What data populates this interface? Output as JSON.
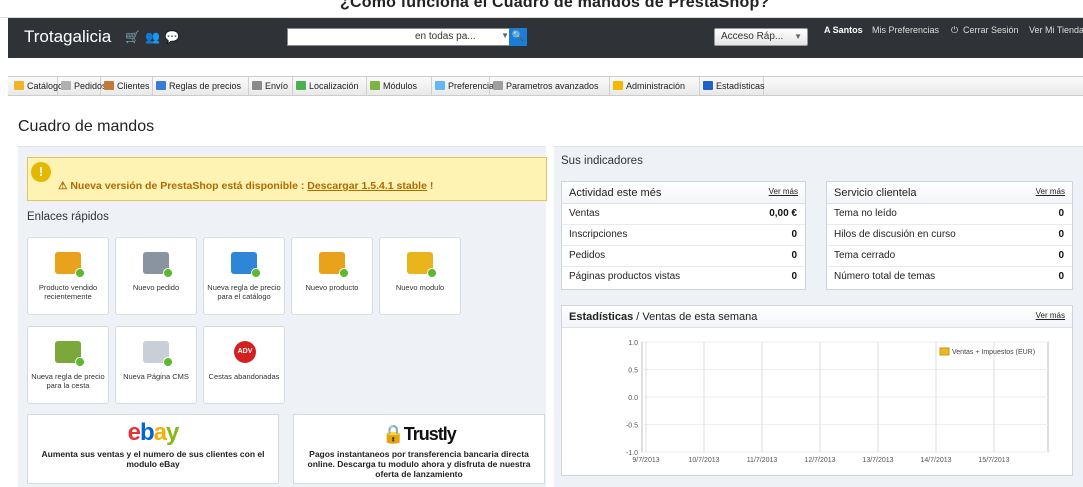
{
  "top_band_title": "¿Cómo funciona el Cuadro de mandos de PrestaShop?",
  "header": {
    "logo": "Trotagalicia",
    "search_scope": "en todas pa...",
    "quick_access": "Acceso Ráp...",
    "user_name": "A Santos",
    "preferences": "Mis Preferencias",
    "logout": "Cerrar Sesión",
    "view_store": "Ver Mi Tienda"
  },
  "menu": [
    {
      "label": "Catálogo",
      "color": "#f0b429"
    },
    {
      "label": "Pedidos",
      "color": "#b0b0b0"
    },
    {
      "label": "Clientes",
      "color": "#c07a3a"
    },
    {
      "label": "Reglas de precios",
      "color": "#3a7bd5"
    },
    {
      "label": "Envío",
      "color": "#8a8a8a"
    },
    {
      "label": "Localización",
      "color": "#4caf50"
    },
    {
      "label": "Módulos",
      "color": "#7cb342"
    },
    {
      "label": "Preferencias",
      "color": "#64b5f6"
    },
    {
      "label": "Parametros avanzados",
      "color": "#9e9e9e"
    },
    {
      "label": "Administración",
      "color": "#f5b800"
    },
    {
      "label": "Estadísticas",
      "color": "#1e63c7"
    }
  ],
  "page_title": "Cuadro de mandos",
  "alert": {
    "text": "Nueva versión de PrestaShop está disponible :",
    "link": "Descargar 1.5.4.1 stable",
    "suffix": "!"
  },
  "quick_links": {
    "title": "Enlaces rápidos",
    "tiles": [
      {
        "label": "Producto vendido recientemente",
        "icon": "folder-arrow-icon"
      },
      {
        "label": "Nuevo pedido",
        "icon": "cart-add-icon"
      },
      {
        "label": "Nueva regla de precio para el catálogo",
        "icon": "book-icon"
      },
      {
        "label": "Nuevo producto",
        "icon": "folder-add-icon"
      },
      {
        "label": "Nuevo modulo",
        "icon": "puzzle-add-icon"
      },
      {
        "label": "Nueva regla de precio para la cesta",
        "icon": "cart-rule-icon"
      },
      {
        "label": "Nueva Página CMS",
        "icon": "page-add-icon"
      },
      {
        "label": "Cestas abandonadas",
        "icon": "adv-icon"
      }
    ]
  },
  "promos": {
    "ebay_logo": "ebay",
    "ebay_text": "Aumenta sus ventas y el numero de sus clientes con el modulo eBay",
    "trustly_logo": "Trustly",
    "trustly_text": "Pagos instantaneos por transferencia bancaria directa online. Descarga tu modulo ahora y disfruta de nuestra oferta de lanzamiento"
  },
  "indicators": {
    "title": "Sus indicadores",
    "activity": {
      "title": "Actividad este més",
      "more": "Ver más",
      "rows": [
        {
          "label": "Ventas",
          "value": "0,00 €"
        },
        {
          "label": "Inscripciones",
          "value": "0"
        },
        {
          "label": "Pedidos",
          "value": "0"
        },
        {
          "label": "Páginas productos vistas",
          "value": "0"
        }
      ]
    },
    "service": {
      "title": "Servicio clientela",
      "more": "Ver más",
      "rows": [
        {
          "label": "Tema no leído",
          "value": "0"
        },
        {
          "label": "Hilos de discusión en curso",
          "value": "0"
        },
        {
          "label": "Tema cerrado",
          "value": "0"
        },
        {
          "label": "Número total de temas",
          "value": "0"
        }
      ]
    }
  },
  "stats": {
    "title_bold": "Estadísticas",
    "title_rest": "/ Ventas de esta semana",
    "more": "Ver más"
  },
  "chart_data": {
    "type": "line",
    "x": [
      "9/7/2013",
      "10/7/2013",
      "11/7/2013",
      "12/7/2013",
      "13/7/2013",
      "14/7/2013",
      "15/7/2013"
    ],
    "series": [
      {
        "name": "Ventas + Impuestos (EUR)",
        "values": [
          0,
          0,
          0,
          0,
          0,
          0,
          0
        ],
        "color": "#f0b429"
      }
    ],
    "yticks": [
      "1.0",
      "0.5",
      "0.0",
      "-0.5",
      "-1.0"
    ],
    "ylim": [
      -1.0,
      1.0
    ],
    "legend": "top-right",
    "grid": true
  }
}
